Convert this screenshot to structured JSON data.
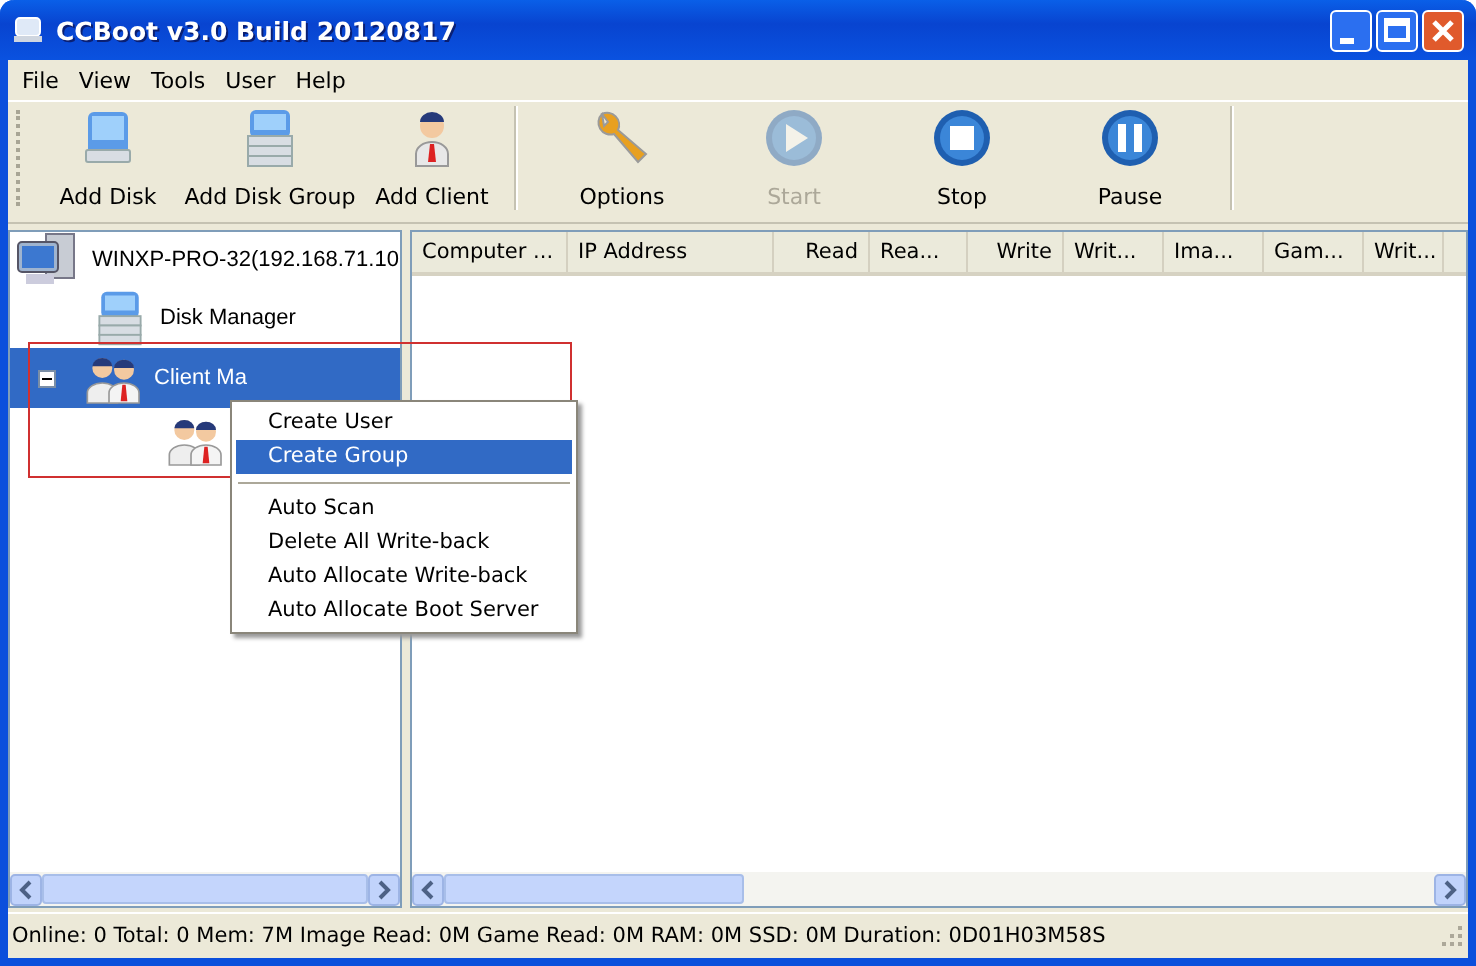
{
  "window": {
    "title": "CCBoot v3.0 Build 20120817"
  },
  "menu_bar": [
    "File",
    "View",
    "Tools",
    "User",
    "Help"
  ],
  "toolbar": [
    {
      "label": "Add Disk",
      "disabled": false
    },
    {
      "label": "Add Disk Group",
      "disabled": false
    },
    {
      "label": "Add Client",
      "disabled": false
    },
    {
      "label": "Options",
      "disabled": false
    },
    {
      "label": "Start",
      "disabled": true
    },
    {
      "label": "Stop",
      "disabled": false
    },
    {
      "label": "Pause",
      "disabled": false
    }
  ],
  "tree": [
    {
      "label": "WINXP-PRO-32(192.168.71.10",
      "selected": false,
      "children": [
        {
          "label": "Disk Manager",
          "selected": false
        },
        {
          "label": "Client Ma",
          "selected": true,
          "expanded": true,
          "children": [
            {
              "selected": false
            }
          ]
        }
      ]
    }
  ],
  "table": {
    "columns": [
      "Computer ...",
      "IP Address",
      "Read",
      "Rea...",
      "Write",
      "Writ...",
      "Ima...",
      "Gam...",
      "Writ..."
    ]
  },
  "context_menu": [
    {
      "label": "Create User",
      "selected": false,
      "kind": "item"
    },
    {
      "label": "Create Group",
      "selected": true,
      "kind": "item"
    },
    {
      "kind": "separator"
    },
    {
      "label": "Auto Scan",
      "selected": false,
      "kind": "item"
    },
    {
      "label": "Delete All Write-back",
      "selected": false,
      "kind": "item"
    },
    {
      "label": "Auto Allocate Write-back",
      "selected": false,
      "kind": "item"
    },
    {
      "label": "Auto Allocate Boot Server",
      "selected": false,
      "kind": "item"
    }
  ],
  "status_bar": "Online: 0 Total: 0 Mem: 7M Image Read: 0M Game Read: 0M RAM: 0M SSD: 0M Duration: 0D01H03M58S"
}
